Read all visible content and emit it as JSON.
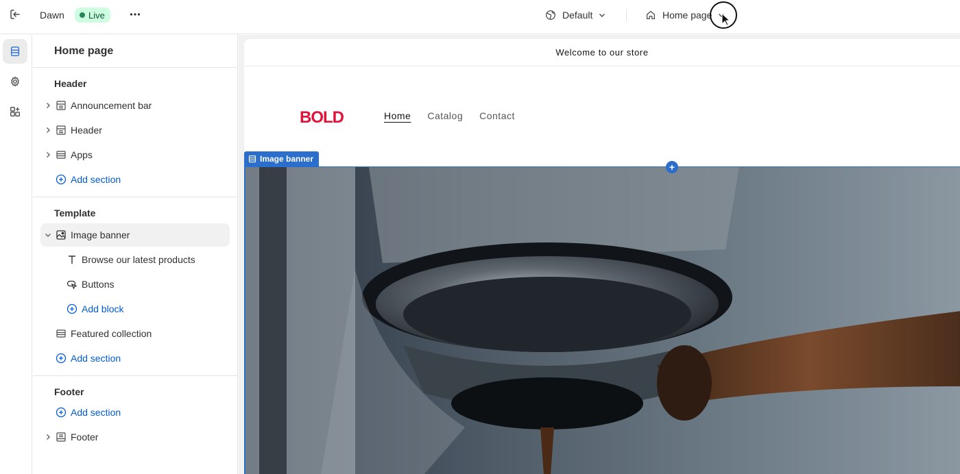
{
  "topbar": {
    "theme_name": "Dawn",
    "status_badge": "Live",
    "template_selector": "Default",
    "page_selector": "Home page"
  },
  "sidebar": {
    "title": "Home page",
    "groups": [
      {
        "title": "Header",
        "items": [
          {
            "label": "Announcement bar",
            "icon": "section-icon"
          },
          {
            "label": "Header",
            "icon": "section-icon"
          },
          {
            "label": "Apps",
            "icon": "apps-section-icon"
          }
        ],
        "add_label": "Add section"
      },
      {
        "title": "Template",
        "items": [
          {
            "label": "Image banner",
            "icon": "image-icon",
            "expanded": true,
            "blocks": [
              {
                "label": "Browse our latest products",
                "icon": "text-icon"
              },
              {
                "label": "Buttons",
                "icon": "button-icon"
              }
            ],
            "add_block_label": "Add block"
          },
          {
            "label": "Featured collection",
            "icon": "section-icon"
          }
        ],
        "add_label": "Add section"
      },
      {
        "title": "Footer",
        "items": [
          {
            "label": "Footer",
            "icon": "footer-icon"
          }
        ],
        "add_label": "Add section"
      }
    ]
  },
  "preview": {
    "announcement": "Welcome to our store",
    "logo_text": "BOLD",
    "nav": [
      "Home",
      "Catalog",
      "Contact"
    ],
    "selected_section_tag": "Image banner",
    "add_marker": "+"
  },
  "colors": {
    "accent": "#2c6ecb",
    "link": "#005bd3",
    "live_bg": "#cdfee1",
    "live_dot": "#29845a",
    "logo": "#e0123a"
  }
}
